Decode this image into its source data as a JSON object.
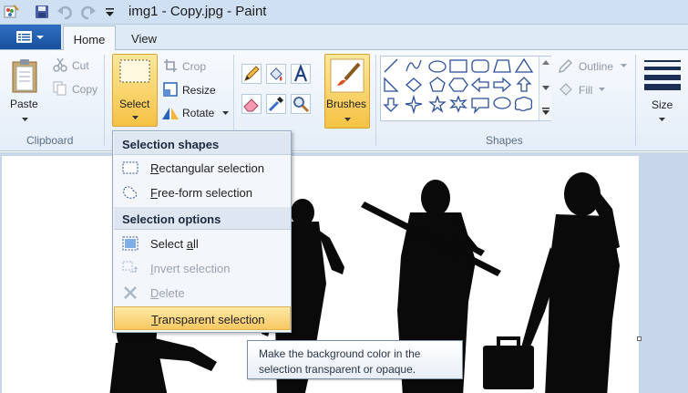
{
  "window": {
    "title": "img1 - Copy.jpg - Paint"
  },
  "tabs": [
    {
      "label": "Home",
      "active": true
    },
    {
      "label": "View",
      "active": false
    }
  ],
  "ribbon": {
    "clipboard": {
      "label": "Clipboard",
      "paste": "Paste",
      "cut": "Cut",
      "copy": "Copy"
    },
    "image": {
      "select": "Select",
      "crop": "Crop",
      "resize": "Resize",
      "rotate": "Rotate"
    },
    "tools": {
      "brushes": "Brushes"
    },
    "shapes": {
      "label": "Shapes",
      "outline": "Outline",
      "fill": "Fill"
    },
    "size": "Size"
  },
  "select_menu": {
    "header_shapes": "Selection shapes",
    "header_options": "Selection options",
    "items": [
      {
        "prefix": "",
        "accel": "R",
        "rest": "ectangular selection",
        "enabled": true
      },
      {
        "prefix": "",
        "accel": "F",
        "rest": "ree-form selection",
        "enabled": true
      },
      {
        "prefix": "Select ",
        "accel": "a",
        "rest": "ll",
        "enabled": true
      },
      {
        "prefix": "",
        "accel": "I",
        "rest": "nvert selection",
        "enabled": false
      },
      {
        "prefix": "",
        "accel": "D",
        "rest": "elete",
        "enabled": false
      },
      {
        "prefix": "",
        "accel": "T",
        "rest": "ransparent selection",
        "enabled": true,
        "highlighted": true
      }
    ]
  },
  "tooltip": {
    "line1": "Make the background color in the",
    "line2": "selection transparent or opaque."
  },
  "colors": {
    "accent_highlight": "#f8c861",
    "ribbon_bg": "#e4edf8",
    "file_button": "#1f5aa8"
  }
}
